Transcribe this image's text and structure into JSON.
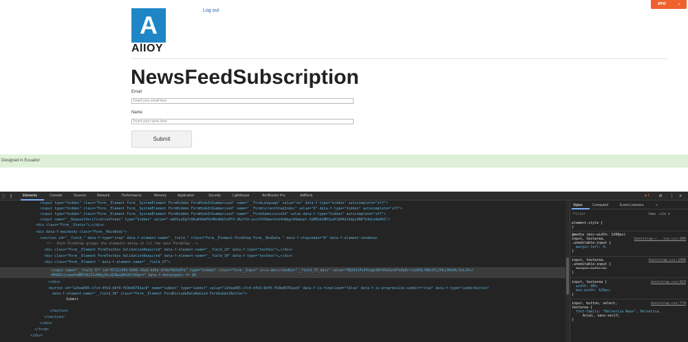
{
  "page": {
    "logo_letter": "A",
    "logo_text": "AlIOY",
    "logout": "Log out",
    "title": "NewsFeedSubscription",
    "email_label": "Email",
    "email_placeholder": "Insert your email here",
    "name_label": "Name",
    "name_placeholder": "Insert your name here",
    "submit": "Submit",
    "footer": "Designed in Ecuador",
    "extension_logo": "ᴇᴘᴏ"
  },
  "devtools": {
    "tabs": [
      "Elements",
      "Console",
      "Sources",
      "Network",
      "Performance",
      "Memory",
      "Application",
      "Security",
      "Lighthouse",
      "Ad-Blocker Pro",
      "AdBlock"
    ],
    "error_count": "1",
    "code_lines": [
      "<input type=\"hidden\" class=\"Form__Element Form__SystemElement FormHidden FormHideInSummarized\" name=\"__FormLanguage\" value=\"en\" data-f-type=\"hidden\" autocomplete=\"off\">",
      "<input type=\"hidden\" class=\"Form__Element Form__SystemElement FormHidden FormHideInSummarized\" name=\"__FormCurrentStepIndex\" value=\"0\" data-f-type=\"hidden\" autocomplete=\"off\">",
      "<input type=\"hidden\" class=\"Form__Element Form__SystemElement FormHidden FormHideInSummarized\" name=\"__FormSubmissionId\" value data-f-type=\"hidden\" autocomplete=\"off\">",
      "<input name=\"__RequestVerificationToken\" type=\"hidden\" value=\"-mdXkyq5g7cQKuW1RmPHiHKnAQkScRF4-2KyYtU-uvcC9lDQmwsXvb4sRmgckHwmopt-3yMEbk2NMJywP1bHKbJkdpuONE7k4qle9wH41\">",
      "<div class=\"Form__Status\">…</div>",
      "<div data-f-mainbody class=\"Form__MainBody\">",
      "<section id=\"__field_\" data-f-type=\"step\" data-f-element-name=\"__field_\" class=\"Form__Element FormStep Form__NonData \" data-f-stepindex=\"0\" data-f-element-nondata>",
      "<!-- Each FormStep groups the elements below it til the next FormStep -->",
      "<div class=\"Form__Element FormTextbox ValidationRequired\" data-f-element-name=\"__field_29\" data-f-type=\"textbox\">…</div>",
      "<div class=\"Form__Element FormTextbox ValidationRequired\" data-f-element-name=\"__field_30\" data-f-type=\"textbox\">…</div>",
      "<div class=\"Form__Element \" data-f-element-name=\"__field_37\">",
      "<input name=\"__field_37\" id=\"6711c45b-6d06-43e9-bd5e-df0a79b5e0fe\" type=\"hidden\" class=\"Form__Input\" aria-describedby=\"__field_37_desc\" value=\"HQ2hh1Fv54sqgtK0fdhQ1wo07eUpRrr/pd93LtNDxOIjJHGj9He9k/1oL2V+/",
      "dH9AZvjcaaaFeNNYV8ZIIzHHgjHLsQJ6wu9HiDtYd9g==\" data-f-datainput> == $0",
      "</div>",
      "<button id=\"1e5ea095-c7c4-4fb3-8df0-f63bd0781ac8\" name=\"submit\" type=\"submit\" value=\"1e5ea095-c7c4-4fb3-8df0-f63bd0781ac8\" data-f-is-finalized=\"false\" data-f-is-progressive-submit=\"true\" data-f-type=\"submitbutton\"",
      "data-f-element-name=\"__field_38\" class=\"Form__Element FormExcludeDataRebind FormSubmitButton\">",
      "Submit",
      "</button>",
      "</section>",
      "</div>",
      "</form>",
      "</div>"
    ],
    "styles_tabs": [
      "Styles",
      "Computed",
      "Event Listeners"
    ],
    "styles_filter": "Filter",
    "styles_hov": ":hov .cls +",
    "rules": [
      {
        "selector": "element.style {",
        "body": [
          "}"
        ]
      },
      {
        "selector": "@media (min-width: 1200px)",
        "selector2": "input, textarea,",
        "selector3": ".uneditable-input {",
        "source": "bootstrap-r...ive.css:880",
        "body": [
          "margin-left: 0;",
          "}"
        ]
      },
      {
        "selector": "input, textarea,",
        "selector2": ".uneditable-input {",
        "source": "bootstrap.css:1006",
        "body": [
          "margin-left: 0;",
          "}"
        ]
      },
      {
        "selector": "input, textarea {",
        "source": "bootstrap.css:810",
        "body": [
          "width: 98%;",
          "max-width: 620px;",
          "}"
        ]
      },
      {
        "selector": "input, button, select,",
        "selector2": "textarea {",
        "source": "bootstrap.css:774",
        "body": [
          "font-family: \"Helvetica Neue\", Helvetica,",
          "Arial, sans-serif;",
          "}"
        ]
      }
    ]
  }
}
